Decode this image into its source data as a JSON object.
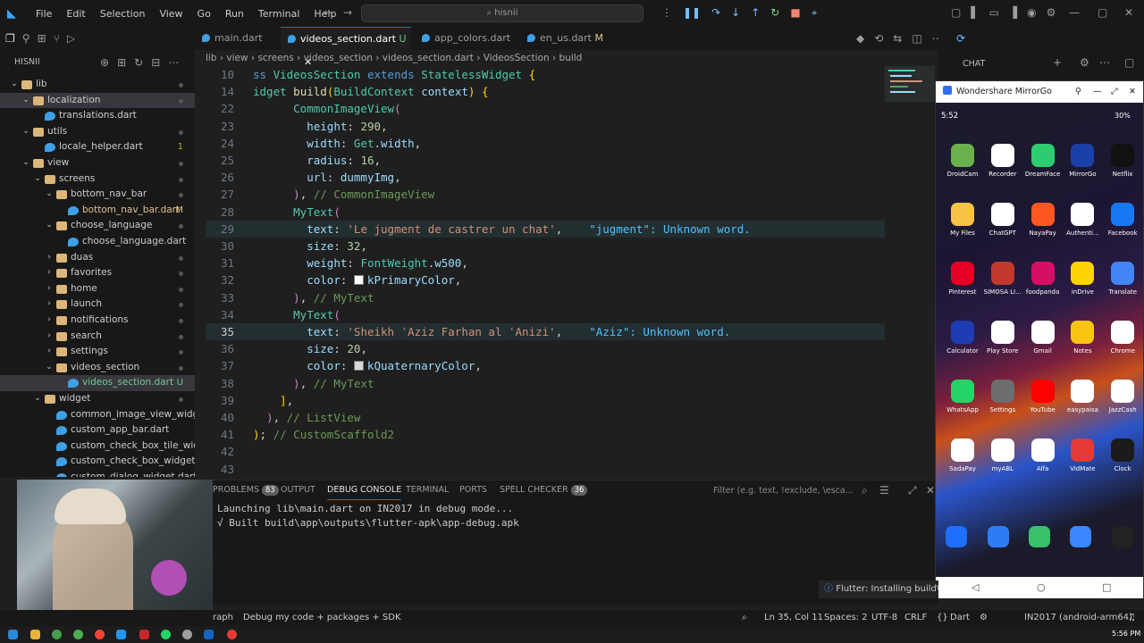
{
  "titlebar": {
    "menus": [
      "File",
      "Edit",
      "Selection",
      "View",
      "Go",
      "Run",
      "Terminal",
      "Help"
    ],
    "search": "hisnii"
  },
  "explorer": {
    "title": "HISNII",
    "items": [
      {
        "label": "lib",
        "kind": "folder",
        "open": true,
        "depth": 0
      },
      {
        "label": "localization",
        "kind": "folder",
        "open": true,
        "depth": 1,
        "selected": true
      },
      {
        "label": "translations.dart",
        "kind": "dart",
        "depth": 2
      },
      {
        "label": "utils",
        "kind": "folder",
        "open": true,
        "depth": 1
      },
      {
        "label": "locale_helper.dart",
        "kind": "dart",
        "depth": 2,
        "badge": "1"
      },
      {
        "label": "view",
        "kind": "folder",
        "open": true,
        "depth": 1
      },
      {
        "label": "screens",
        "kind": "folder",
        "open": true,
        "depth": 2
      },
      {
        "label": "bottom_nav_bar",
        "kind": "folder",
        "open": true,
        "depth": 3
      },
      {
        "label": "bottom_nav_bar.dart",
        "kind": "dart",
        "depth": 4,
        "badge": "M"
      },
      {
        "label": "choose_language",
        "kind": "folder",
        "open": true,
        "depth": 3
      },
      {
        "label": "choose_language.dart",
        "kind": "dart",
        "depth": 4
      },
      {
        "label": "duas",
        "kind": "folder",
        "depth": 3
      },
      {
        "label": "favorites",
        "kind": "folder",
        "depth": 3
      },
      {
        "label": "home",
        "kind": "folder",
        "depth": 3
      },
      {
        "label": "launch",
        "kind": "folder",
        "depth": 3
      },
      {
        "label": "notifications",
        "kind": "folder",
        "depth": 3
      },
      {
        "label": "search",
        "kind": "folder",
        "depth": 3
      },
      {
        "label": "settings",
        "kind": "folder",
        "depth": 3
      },
      {
        "label": "videos_section",
        "kind": "folder",
        "open": true,
        "depth": 3
      },
      {
        "label": "videos_section.dart",
        "kind": "dart",
        "depth": 4,
        "badge": "U",
        "selected": true
      },
      {
        "label": "widget",
        "kind": "folder",
        "open": true,
        "depth": 2
      },
      {
        "label": "common_image_view_widget.dart",
        "kind": "dart",
        "depth": 3
      },
      {
        "label": "custom_app_bar.dart",
        "kind": "dart",
        "depth": 3
      },
      {
        "label": "custom_check_box_tile_widget.d...",
        "kind": "dart",
        "depth": 3
      },
      {
        "label": "custom_check_box_widget.dart",
        "kind": "dart",
        "depth": 3
      },
      {
        "label": "custom_dialog_widget.dart",
        "kind": "dart",
        "depth": 3
      }
    ]
  },
  "tabs": [
    {
      "label": "main.dart",
      "badge": ""
    },
    {
      "label": "videos_section.dart",
      "badge": "U",
      "active": true
    },
    {
      "label": "app_colors.dart",
      "badge": ""
    },
    {
      "label": "en_us.dart",
      "badge": "M"
    }
  ],
  "breadcrumb": [
    "lib",
    "view",
    "screens",
    "videos_section",
    "videos_section.dart",
    "VideosSection",
    "build"
  ],
  "editor": {
    "lines": [
      {
        "n": "10",
        "html": "<span class='k'>ss</span> <span class='t'>VideosSection</span> <span class='k'>extends</span> <span class='t'>StatelessWidget</span> <span class='y'>{</span>"
      },
      {
        "n": "14",
        "html": "<span class='t'>idget</span> <span class='f'>build</span><span class='y'>(</span><span class='t'>BuildContext</span> <span class='p'>context</span><span class='y'>)</span> <span class='y'>{</span>"
      },
      {
        "n": "22",
        "html": "      <span class='t'>CommonImageView</span><span class='x'>(</span>"
      },
      {
        "n": "23",
        "html": "        <span class='p'>height</span><span class='w'>:</span> <span class='n'>290</span><span class='w'>,</span>"
      },
      {
        "n": "24",
        "html": "        <span class='p'>width</span><span class='w'>:</span> <span class='t'>Get</span><span class='w'>.</span><span class='p'>width</span><span class='w'>,</span>"
      },
      {
        "n": "25",
        "html": "        <span class='p'>radius</span><span class='w'>:</span> <span class='n'>16</span><span class='w'>,</span>"
      },
      {
        "n": "26",
        "html": "        <span class='p'>url</span><span class='w'>:</span> <span class='p'>dummyImg</span><span class='w'>,</span>"
      },
      {
        "n": "27",
        "html": "      <span class='x'>)</span><span class='w'>,</span> <span class='c'>// CommonImageView</span>"
      },
      {
        "n": "28",
        "html": "      <span class='t'>MyText</span><span class='x'>(</span>"
      },
      {
        "n": "29",
        "html": "        <span class='p'>text</span><span class='w'>:</span> <span class='s'>'Le jugment de castrer un chat'</span><span class='w'>,</span><span class='diag'>\"jugment\": Unknown word.</span>",
        "hl": true
      },
      {
        "n": "30",
        "html": "        <span class='p'>size</span><span class='w'>:</span> <span class='n'>32</span><span class='w'>,</span>"
      },
      {
        "n": "31",
        "html": "        <span class='p'>weight</span><span class='w'>:</span> <span class='t'>FontWeight</span><span class='w'>.</span><span class='p'>w500</span><span class='w'>,</span>"
      },
      {
        "n": "32",
        "html": "        <span class='p'>color</span><span class='w'>:</span> <span class='swatch' style='background:#ffffff'></span><span class='p'>kPrimaryColor</span><span class='w'>,</span>"
      },
      {
        "n": "33",
        "html": "      <span class='x'>)</span><span class='w'>,</span> <span class='c'>// MyText</span>"
      },
      {
        "n": "34",
        "html": "      <span class='t'>MyText</span><span class='x'>(</span>"
      },
      {
        "n": "35",
        "html": "        <span class='p'>text</span><span class='w'>:</span> <span class='s'>'Sheikh ʿAziz Farhan al ʿAnizi'</span><span class='w'>,</span><span class='diag'>\"Aziz\": Unknown word.</span>",
        "hl": true,
        "cur": true
      },
      {
        "n": "36",
        "html": "        <span class='p'>size</span><span class='w'>:</span> <span class='n'>20</span><span class='w'>,</span>"
      },
      {
        "n": "37",
        "html": "        <span class='p'>color</span><span class='w'>:</span> <span class='swatch' style='background:#d8d8d8'></span><span class='p'>kQuaternaryColor</span><span class='w'>,</span>"
      },
      {
        "n": "38",
        "html": "      <span class='x'>)</span><span class='w'>,</span> <span class='c'>// MyText</span>"
      },
      {
        "n": "39",
        "html": "    <span class='y'>]</span><span class='w'>,</span>"
      },
      {
        "n": "40",
        "html": "  <span class='x'>)</span><span class='w'>,</span> <span class='c'>// ListView</span>"
      },
      {
        "n": "41",
        "html": "<span class='y'>)</span><span class='w'>;</span> <span class='c'>// CustomScaffold2</span>"
      },
      {
        "n": "42",
        "html": ""
      },
      {
        "n": "43",
        "html": ""
      }
    ]
  },
  "panel": {
    "tabs": [
      {
        "label": "PROBLEMS",
        "badge": "83"
      },
      {
        "label": "OUTPUT"
      },
      {
        "label": "DEBUG CONSOLE",
        "active": true
      },
      {
        "label": "TERMINAL"
      },
      {
        "label": "PORTS"
      },
      {
        "label": "SPELL CHECKER",
        "badge": "36"
      }
    ],
    "filter": "Filter (e.g. text, !exclude, \\esca...",
    "lines": [
      "Launching lib\\main.dart on IN2017 in debug mode...",
      "√ Built build\\app\\outputs\\flutter-apk\\app-debug.apk"
    ]
  },
  "statusbar": {
    "left1": "raph",
    "left2": "Debug my code + packages + SDK",
    "pos": "Ln 35, Col 11",
    "spaces": "Spaces: 2",
    "encoding": "UTF-8",
    "eol": "CRLF",
    "lang": "Dart",
    "device": "IN2017 (android-arm64)"
  },
  "toast": "Flutter: Installing build\\",
  "chat": {
    "title": "CHAT"
  },
  "mirror": {
    "title": "Wondershare MirrorGo",
    "time": "5:52",
    "battery": "30%",
    "apps": [
      [
        "DroidCam",
        "Recorder",
        "DreamFace",
        "MirrorGo",
        "Netflix"
      ],
      [
        "My Files",
        "ChatGPT",
        "NayaPay",
        "Authenti...",
        "Facebook"
      ],
      [
        "Pinterest",
        "SIMOSA LI...",
        "foodpanda",
        "inDrive",
        "Translate"
      ],
      [
        "Calculator",
        "Play Store",
        "Gmail",
        "Notes",
        "Chrome"
      ],
      [
        "WhatsApp",
        "Settings",
        "YouTube",
        "easypaisa",
        "JazzCash"
      ],
      [
        "SadaPay",
        "myABL",
        "Alfa",
        "VidMate",
        "Clock"
      ]
    ]
  },
  "clock": "5:56 PM",
  "colors": {
    "accent": "#0078d4"
  }
}
